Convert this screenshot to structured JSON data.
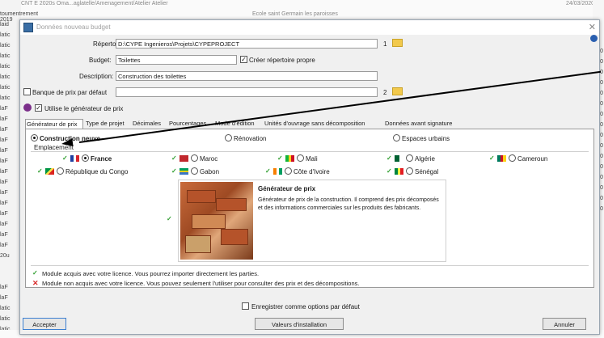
{
  "background": {
    "top_left_fragment": "CNT et CNT E 2020s Oma...aglatelle/Amenagement/Atelier Atelier",
    "top_mid_fragment": "Ecole saint Germain les paroisses",
    "top_right_fragment": "24/03/2020",
    "left_rows": [
      "toumentrement 2019",
      "laid",
      "latic",
      "latic",
      "latic",
      "latic",
      "latic",
      "latic",
      "latic",
      "laF",
      "laF",
      "laF",
      "laF",
      "laF",
      "laF",
      "laF",
      "laF",
      "laF",
      "laF",
      "laF",
      "laF",
      "laF",
      "laF",
      "20u",
      "",
      "",
      "laF",
      "laF",
      "latic",
      "latic",
      "latic"
    ],
    "right_rows": [
      "20",
      "20",
      "20",
      "20",
      "20",
      "20",
      "20",
      "20",
      "20",
      "20",
      "20",
      "20",
      "20",
      "20",
      "20",
      "20"
    ]
  },
  "dialog": {
    "title": "Données nouveau budget",
    "repertoire_label": "Répertoire:",
    "repertoire_value": "D:\\CYPE Ingenieros\\Projets\\CYPEPROJECT",
    "repertoire_num": "1",
    "budget_label": "Budget:",
    "budget_value": "Toilettes",
    "creer_repertoire_label": "Créer répertoire propre",
    "description_label": "Description:",
    "description_value": "Construction des toilettes",
    "banque_label": "Banque de prix par défaut",
    "banque_value": "",
    "banque_num": "2",
    "utilise_generateur_label": "Utilise le générateur de prix",
    "tabs": [
      "Générateur de prix",
      "Type de projet",
      "Décimales",
      "Pourcentages",
      "Mode d'édition",
      "Unités d'ouvrage sans décomposition",
      "Données avant signature"
    ],
    "radio_construction": "Construction neuve",
    "radio_renovation": "Rénovation",
    "radio_espaces": "Espaces urbains",
    "emplacement_label": "Emplacement",
    "countries_row1": [
      "France",
      "Maroc",
      "Mali",
      "Algérie",
      "Cameroun"
    ],
    "countries_row2": [
      "République du Congo",
      "Gabon",
      "Côte d'Ivoire",
      "Sénégal"
    ],
    "gen_title": "Générateur de prix",
    "gen_desc": "Générateur de prix de la construction. Il comprend des prix décomposés et des informations commerciales sur les produits des fabricants.",
    "module_acquis": "Module acquis avec votre licence. Vous pourrez importer directement les parties.",
    "module_non_acquis": "Module non acquis avec votre licence. Vous pouvez seulement l'utiliser pour consulter des prix et des décompositions.",
    "enregistrer_label": "Enregistrer comme options par défaut",
    "accepter": "Accepter",
    "valeurs": "Valeurs d'installation",
    "annuler": "Annuler"
  },
  "colors": {
    "check_green": "#2e9d2e",
    "cross_red": "#d92b2b",
    "folder": "#f2c94c",
    "accent_blue": "#3c7fd0"
  }
}
